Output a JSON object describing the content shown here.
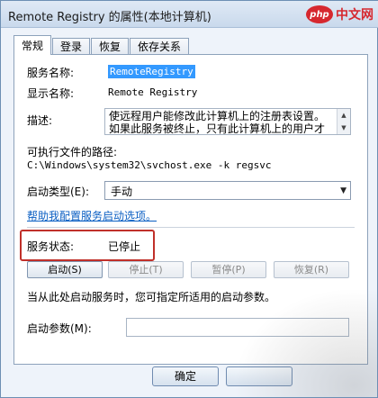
{
  "window": {
    "title": "Remote Registry 的属性(本地计算机)"
  },
  "tabs": [
    {
      "label": "常规"
    },
    {
      "label": "登录"
    },
    {
      "label": "恢复"
    },
    {
      "label": "依存关系"
    }
  ],
  "general": {
    "service_name_label": "服务名称:",
    "service_name_value": "RemoteRegistry",
    "display_name_label": "显示名称:",
    "display_name_value": "Remote Registry",
    "description_label": "描述:",
    "description_line1": "使远程用户能修改此计算机上的注册表设置。",
    "description_line2": "如果此服务被终止，只有此计算机上的用户才",
    "exec_path_label": "可执行文件的路径:",
    "exec_path_value": "C:\\Windows\\system32\\svchost.exe -k regsvc",
    "startup_type_label": "启动类型(E):",
    "startup_type_value": "手动",
    "help_link": "帮助我配置服务启动选项。",
    "status_label": "服务状态:",
    "status_value": "已停止",
    "start_button": "启动(S)",
    "stop_button": "停止(T)",
    "pause_button": "暂停(P)",
    "resume_button": "恢复(R)",
    "hint_text": "当从此处启动服务时，您可指定所适用的启动参数。",
    "params_label": "启动参数(M):",
    "params_value": ""
  },
  "footer": {
    "ok_button": "确定"
  },
  "watermark": {
    "logo_text": "php",
    "logo_suffix": "中文网"
  },
  "colors": {
    "accent": "#3399ff",
    "status_border": "#c0302a",
    "link": "#0b5fc3"
  }
}
